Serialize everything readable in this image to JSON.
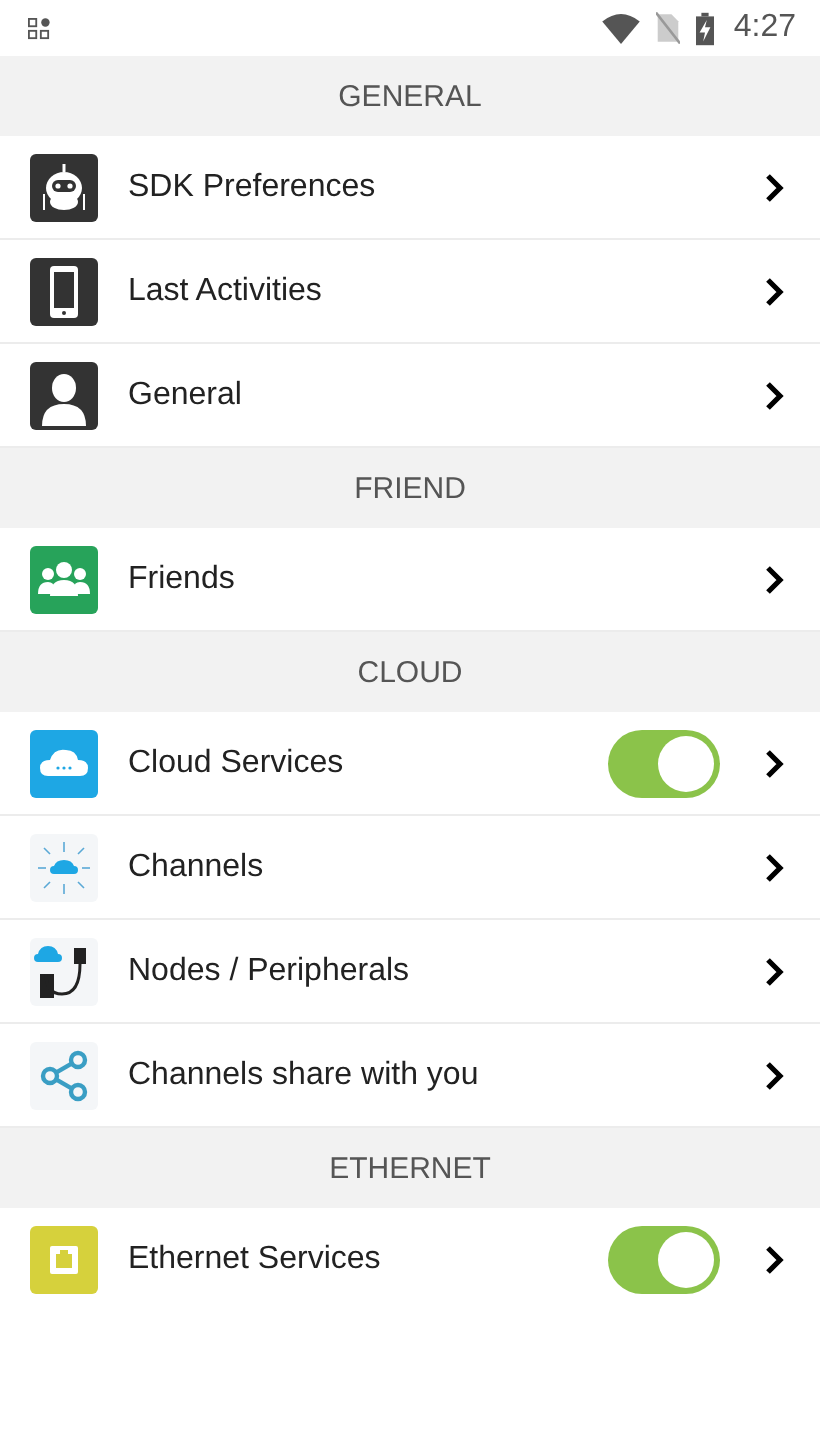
{
  "status_bar": {
    "time": "4:27"
  },
  "sections": [
    {
      "title": "GENERAL",
      "items": [
        {
          "label": "SDK Preferences",
          "kind": "link"
        },
        {
          "label": "Last Activities",
          "kind": "link"
        },
        {
          "label": "General",
          "kind": "link"
        }
      ]
    },
    {
      "title": "FRIEND",
      "items": [
        {
          "label": "Friends",
          "kind": "link"
        }
      ]
    },
    {
      "title": "CLOUD",
      "items": [
        {
          "label": "Cloud Services",
          "kind": "toggle",
          "on": true
        },
        {
          "label": "Channels",
          "kind": "link"
        },
        {
          "label": "Nodes / Peripherals",
          "kind": "link"
        },
        {
          "label": "Channels share with you",
          "kind": "link"
        }
      ]
    },
    {
      "title": "ETHERNET",
      "items": [
        {
          "label": "Ethernet Services",
          "kind": "toggle",
          "on": true
        }
      ]
    }
  ]
}
